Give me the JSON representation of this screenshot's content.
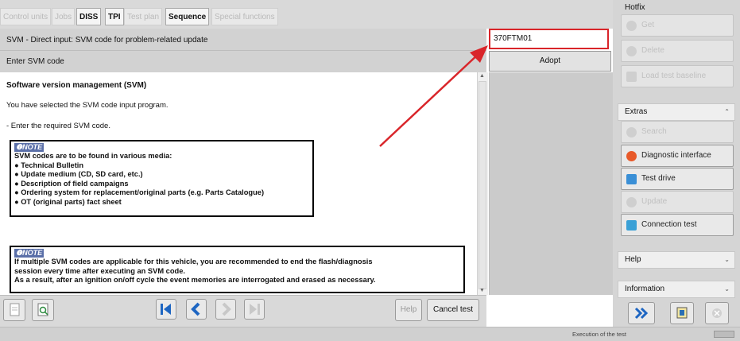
{
  "tabs": [
    {
      "label": "Control units",
      "active": false,
      "disabled": true
    },
    {
      "label": "Jobs",
      "active": false,
      "disabled": true
    },
    {
      "label": "DISS",
      "active": false,
      "disabled": false
    },
    {
      "label": "TPI",
      "active": false,
      "disabled": false
    },
    {
      "label": "Test plan",
      "active": false,
      "disabled": true
    },
    {
      "label": "Sequence",
      "active": true,
      "disabled": false
    },
    {
      "label": "Special functions",
      "active": false,
      "disabled": true
    }
  ],
  "header": {
    "line1": "SVM - Direct input: SVM code for problem-related update",
    "line2": "Enter SVM code"
  },
  "svm_input": {
    "value": "370FTM01"
  },
  "adopt_label": "Adopt",
  "content": {
    "title": "Software version management (SVM)",
    "para1": "You have selected the SVM code input program.",
    "para2": "- Enter the required SVM code.",
    "note1": {
      "heading": "NOTE",
      "intro": "SVM codes are to be found in various media:",
      "items": [
        "Technical Bulletin",
        "Update medium (CD, SD card, etc.)",
        "Description of field campaigns",
        "Ordering system for replacement/original parts (e.g. Parts Catalogue)",
        "OT (original parts) fact sheet"
      ]
    },
    "note2": {
      "heading": "NOTE",
      "line1": "If multiple SVM codes are applicable for this vehicle, you are recommended to end the flash/diagnosis",
      "line2": "session every time after executing an SVM code.",
      "line3": "As a result, after an ignition on/off cycle the event memories are interrogated and erased as necessary."
    }
  },
  "bottom": {
    "help_label": "Help",
    "cancel_label": "Cancel test"
  },
  "right_panel": {
    "hotfix_title": "Hotfix",
    "get_label": "Get",
    "delete_label": "Delete",
    "load_label": "Load test baseline",
    "extras_title": "Extras",
    "search_label": "Search",
    "diag_label": "Diagnostic interface",
    "testdrive_label": "Test drive",
    "update_label": "Update",
    "conn_label": "Connection test",
    "help_title": "Help",
    "info_title": "Information"
  },
  "status": {
    "text": "Execution of the test"
  },
  "colors": {
    "highlight": "#d9252a",
    "nav_blue": "#1e66c2",
    "note_head": "#5a6fa8"
  }
}
